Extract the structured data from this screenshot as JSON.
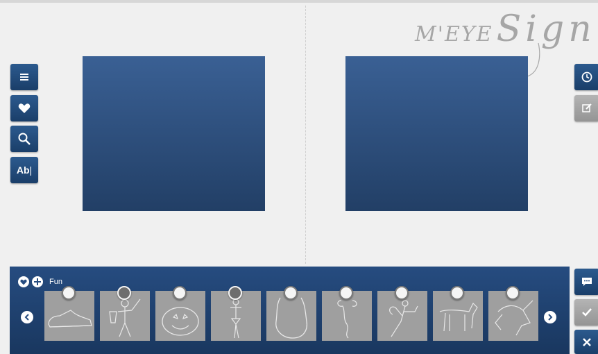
{
  "logo": {
    "text_small": "M'EYE",
    "text_big": "Sign"
  },
  "left_toolbar": [
    {
      "name": "menu-button",
      "icon": "menu-icon"
    },
    {
      "name": "favorites-button",
      "icon": "heart-icon"
    },
    {
      "name": "search-button",
      "icon": "search-icon"
    },
    {
      "name": "text-button",
      "icon": "text-icon",
      "label": "Ab"
    }
  ],
  "right_toolbar": [
    {
      "name": "history-button",
      "icon": "clock-icon"
    },
    {
      "name": "edit-button",
      "icon": "edit-icon"
    }
  ],
  "stencil_bar": {
    "category": "Fun",
    "items": [
      {
        "name": "sneaker",
        "selected": false
      },
      {
        "name": "warrior",
        "selected": true
      },
      {
        "name": "pumpkin",
        "selected": false
      },
      {
        "name": "ballerina",
        "selected": true
      },
      {
        "name": "bear",
        "selected": false
      },
      {
        "name": "seahorse",
        "selected": false
      },
      {
        "name": "fairy",
        "selected": false
      },
      {
        "name": "horse",
        "selected": false
      },
      {
        "name": "unicorn",
        "selected": false
      }
    ]
  },
  "bottom_actions": [
    {
      "name": "comment-button",
      "icon": "comment-icon"
    },
    {
      "name": "confirm-button",
      "icon": "check-icon"
    },
    {
      "name": "close-button",
      "icon": "close-icon"
    }
  ],
  "colors": {
    "accent": "#264c80",
    "panel": "#2e527f",
    "thumb": "#9f9f9f",
    "background": "#f0f0f0"
  }
}
